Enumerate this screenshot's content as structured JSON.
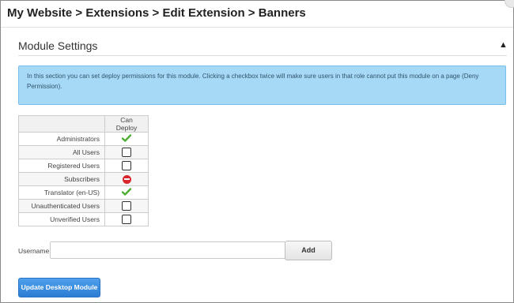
{
  "header": {
    "breadcrumb": "My Website > Extensions > Edit Extension > Banners"
  },
  "module_settings": {
    "title": "Module Settings",
    "info": "In this section you can set deploy permissions for this module. Clicking a checkbox twice will make sure users in that role cannot put this module on a page (Deny Permission).",
    "table": {
      "column_header": "Can Deploy",
      "rows": [
        {
          "role": "Administrators",
          "state": "granted"
        },
        {
          "role": "All Users",
          "state": "unchecked"
        },
        {
          "role": "Registered Users",
          "state": "unchecked"
        },
        {
          "role": "Subscribers",
          "state": "denied"
        },
        {
          "role": "Translator (en-US)",
          "state": "granted"
        },
        {
          "role": "Unauthenticated Users",
          "state": "unchecked"
        },
        {
          "role": "Unverified Users",
          "state": "unchecked"
        }
      ]
    },
    "username": {
      "label": "Username:",
      "value": "",
      "placeholder": ""
    },
    "add_label": "Add",
    "update_label": "Update Desktop Module"
  },
  "colors": {
    "info_bg": "#a6d9f6",
    "granted": "#4caf32",
    "denied": "#d9262c",
    "primary_button": "#2b7dd4"
  }
}
